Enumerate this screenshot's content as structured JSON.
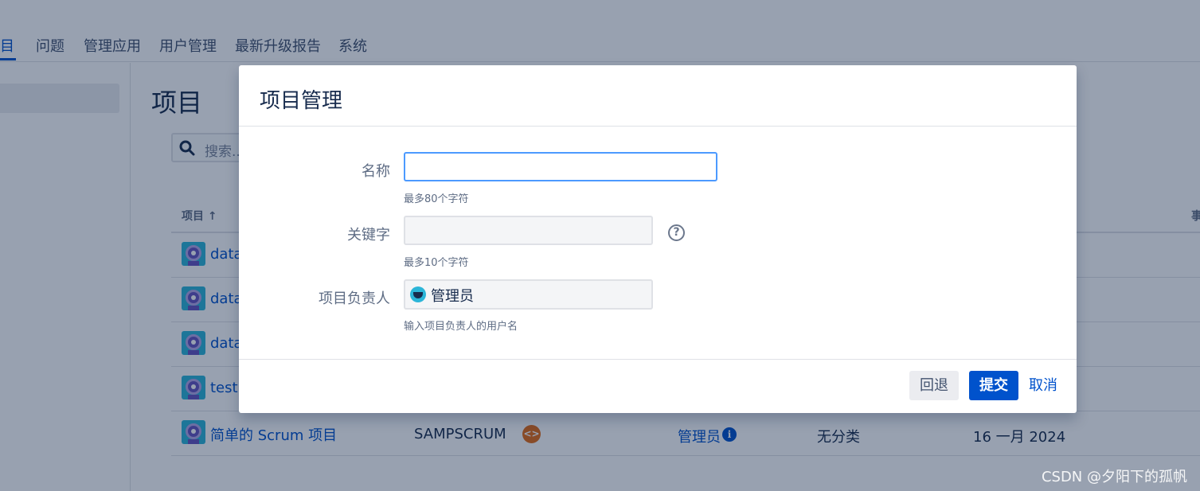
{
  "topnav": {
    "tabs": [
      {
        "label": "项目"
      },
      {
        "label": "问题"
      },
      {
        "label": "管理应用"
      },
      {
        "label": "用户管理"
      },
      {
        "label": "最新升级报告"
      },
      {
        "label": "系统"
      }
    ]
  },
  "main": {
    "title": "项目",
    "search_placeholder": "搜索...",
    "table": {
      "col_project": "项目 ↑",
      "col_last": "事"
    },
    "rows": [
      {
        "name": "data",
        "key": "",
        "lead": "",
        "category": "",
        "date": ""
      },
      {
        "name": "data",
        "key": "",
        "lead": "",
        "category": "",
        "date": ""
      },
      {
        "name": "data",
        "key": "",
        "lead": "",
        "category": "",
        "date": ""
      },
      {
        "name": "test",
        "key": "",
        "lead": "",
        "category": "",
        "date": ""
      },
      {
        "name": "简单的 Scrum 项目",
        "key": "SAMPSCRUM",
        "lead": "管理员",
        "category": "无分类",
        "date": "16 一月 2024"
      }
    ]
  },
  "dialog": {
    "title": "项目管理",
    "fields": {
      "name": {
        "label": "名称",
        "value": "",
        "hint": "最多80个字符"
      },
      "key": {
        "label": "关键字",
        "value": "",
        "hint": "最多10个字符"
      },
      "lead": {
        "label": "项目负责人",
        "value": "管理员",
        "hint": "输入项目负责人的用户名"
      }
    },
    "buttons": {
      "back": "回退",
      "submit": "提交",
      "cancel": "取消"
    }
  },
  "watermark": "CSDN @夕阳下的孤帆",
  "colors": {
    "accent": "#0052cc",
    "focus": "#4c9aff",
    "avatar": "#2bb5d8",
    "type_badge": "#e46c16"
  },
  "icons": {
    "search": "search-icon",
    "help": "question-icon",
    "info": "info-icon",
    "project_type": "software-type-icon"
  }
}
